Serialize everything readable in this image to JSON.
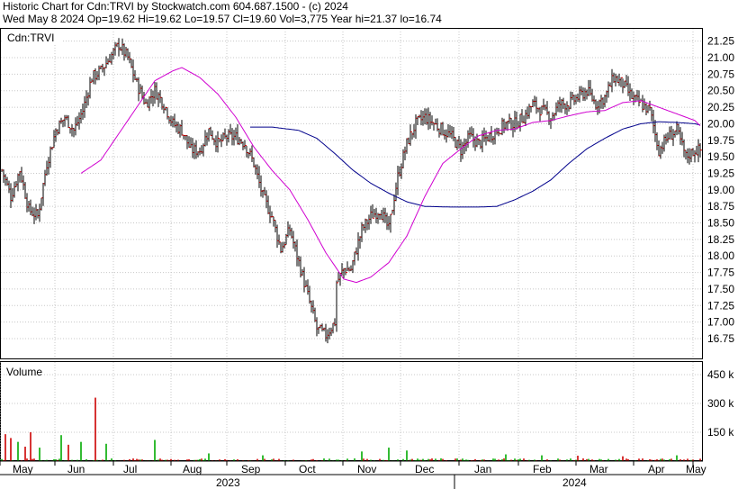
{
  "header": {
    "title_line": "Historic Chart for Cdn:TRVI by Stockwatch.com 604.687.1500 - (c) 2024",
    "stats_line": "Wed May  8 2024  Op=19.62  Hi=19.62  Lo=19.57  Cl=19.60  Vol=3,775  Year hi=21.37  lo=16.74"
  },
  "price_panel": {
    "symbol_label": "Cdn:TRVI"
  },
  "volume_panel": {
    "label": "Volume"
  },
  "colors": {
    "ohlc_bar": "#000000",
    "close_tick": "#cc0000",
    "ma_short": "#d000d0",
    "ma_long": "#00008b",
    "grid": "#c8c8c8",
    "volume_up": "#00aa00",
    "volume_down": "#cc0000"
  },
  "chart_data": {
    "type": "ohlc",
    "price_axis": {
      "ticks": [
        "21.25",
        "21.00",
        "20.75",
        "20.50",
        "20.25",
        "20.00",
        "19.75",
        "19.50",
        "19.25",
        "19.00",
        "18.75",
        "18.50",
        "18.25",
        "18.00",
        "17.75",
        "17.50",
        "17.25",
        "17.00",
        "16.75"
      ],
      "range": [
        16.45,
        21.45
      ]
    },
    "volume_axis": {
      "ticks": [
        "450 k",
        "300 k",
        "150 k"
      ],
      "range": [
        0,
        520000
      ]
    },
    "month_labels": [
      "May",
      "Jun",
      "Jul",
      "Aug",
      "Sep",
      "Oct",
      "Nov",
      "Dec",
      "Jan",
      "Feb",
      "Mar",
      "Apr",
      "May"
    ],
    "year_labels": [
      "2023",
      "2024"
    ],
    "price_keypoints": [
      [
        0,
        19.3
      ],
      [
        5,
        18.9
      ],
      [
        10,
        19.3
      ],
      [
        15,
        18.7
      ],
      [
        20,
        18.6
      ],
      [
        25,
        19.4
      ],
      [
        30,
        19.9
      ],
      [
        35,
        20.1
      ],
      [
        40,
        19.9
      ],
      [
        45,
        20.2
      ],
      [
        50,
        20.7
      ],
      [
        55,
        20.8
      ],
      [
        60,
        21.0
      ],
      [
        65,
        21.2
      ],
      [
        70,
        21.0
      ],
      [
        75,
        20.6
      ],
      [
        80,
        20.3
      ],
      [
        85,
        20.5
      ],
      [
        90,
        20.3
      ],
      [
        95,
        20.0
      ],
      [
        100,
        19.9
      ],
      [
        105,
        19.6
      ],
      [
        110,
        19.6
      ],
      [
        115,
        19.9
      ],
      [
        120,
        19.7
      ],
      [
        125,
        19.8
      ],
      [
        130,
        19.8
      ],
      [
        135,
        19.7
      ],
      [
        140,
        19.4
      ],
      [
        145,
        18.9
      ],
      [
        150,
        18.6
      ],
      [
        155,
        18.1
      ],
      [
        160,
        18.4
      ],
      [
        165,
        17.9
      ],
      [
        170,
        17.4
      ],
      [
        175,
        16.9
      ],
      [
        180,
        16.8
      ],
      [
        185,
        17.0
      ],
      [
        186,
        17.6
      ],
      [
        190,
        17.8
      ],
      [
        194,
        17.8
      ],
      [
        200,
        18.4
      ],
      [
        205,
        18.6
      ],
      [
        210,
        18.7
      ],
      [
        215,
        18.4
      ],
      [
        218,
        18.9
      ],
      [
        220,
        19.2
      ],
      [
        225,
        19.7
      ],
      [
        230,
        20.0
      ],
      [
        235,
        20.1
      ],
      [
        240,
        20.0
      ],
      [
        245,
        19.9
      ],
      [
        250,
        19.8
      ],
      [
        255,
        19.6
      ],
      [
        260,
        19.8
      ],
      [
        265,
        19.7
      ],
      [
        270,
        19.8
      ],
      [
        275,
        19.9
      ],
      [
        280,
        20.0
      ],
      [
        285,
        20.0
      ],
      [
        290,
        20.1
      ],
      [
        295,
        20.3
      ],
      [
        300,
        20.2
      ],
      [
        305,
        20.1
      ],
      [
        310,
        20.3
      ],
      [
        315,
        20.3
      ],
      [
        320,
        20.4
      ],
      [
        325,
        20.5
      ],
      [
        330,
        20.3
      ],
      [
        335,
        20.4
      ],
      [
        340,
        20.7
      ],
      [
        345,
        20.6
      ],
      [
        350,
        20.4
      ],
      [
        355,
        20.3
      ],
      [
        360,
        20.2
      ],
      [
        365,
        19.6
      ],
      [
        370,
        19.8
      ],
      [
        375,
        19.9
      ],
      [
        380,
        19.5
      ],
      [
        385,
        19.6
      ],
      [
        388,
        19.6
      ]
    ],
    "ma_short_keypoints": [
      [
        44,
        19.25
      ],
      [
        55,
        19.45
      ],
      [
        65,
        19.85
      ],
      [
        75,
        20.25
      ],
      [
        85,
        20.65
      ],
      [
        95,
        20.8
      ],
      [
        100,
        20.85
      ],
      [
        110,
        20.7
      ],
      [
        120,
        20.45
      ],
      [
        130,
        20.1
      ],
      [
        140,
        19.65
      ],
      [
        150,
        19.3
      ],
      [
        160,
        19.0
      ],
      [
        170,
        18.55
      ],
      [
        180,
        18.05
      ],
      [
        190,
        17.65
      ],
      [
        197,
        17.6
      ],
      [
        205,
        17.68
      ],
      [
        215,
        17.9
      ],
      [
        225,
        18.3
      ],
      [
        235,
        18.9
      ],
      [
        245,
        19.4
      ],
      [
        255,
        19.62
      ],
      [
        265,
        19.82
      ],
      [
        275,
        19.9
      ],
      [
        285,
        19.92
      ],
      [
        295,
        20.02
      ],
      [
        305,
        20.05
      ],
      [
        315,
        20.12
      ],
      [
        325,
        20.18
      ],
      [
        335,
        20.2
      ],
      [
        345,
        20.32
      ],
      [
        355,
        20.35
      ],
      [
        365,
        20.25
      ],
      [
        375,
        20.15
      ],
      [
        385,
        20.05
      ],
      [
        388,
        19.97
      ]
    ],
    "ma_long_keypoints": [
      [
        138,
        19.95
      ],
      [
        150,
        19.95
      ],
      [
        165,
        19.9
      ],
      [
        175,
        19.78
      ],
      [
        185,
        19.55
      ],
      [
        195,
        19.3
      ],
      [
        205,
        19.1
      ],
      [
        215,
        18.95
      ],
      [
        225,
        18.82
      ],
      [
        235,
        18.75
      ],
      [
        250,
        18.74
      ],
      [
        265,
        18.74
      ],
      [
        275,
        18.75
      ],
      [
        285,
        18.85
      ],
      [
        295,
        18.98
      ],
      [
        305,
        19.15
      ],
      [
        315,
        19.4
      ],
      [
        325,
        19.62
      ],
      [
        335,
        19.78
      ],
      [
        345,
        19.92
      ],
      [
        355,
        20.0
      ],
      [
        365,
        20.03
      ],
      [
        375,
        20.02
      ],
      [
        385,
        20.0
      ],
      [
        388,
        19.98
      ]
    ],
    "volume_spikes": [
      [
        2,
        140000
      ],
      [
        5,
        120000
      ],
      [
        9,
        100000
      ],
      [
        13,
        75000
      ],
      [
        16,
        150000
      ],
      [
        21,
        70000
      ],
      [
        33,
        135000
      ],
      [
        37,
        85000
      ],
      [
        44,
        100000
      ],
      [
        52,
        330000
      ],
      [
        58,
        90000
      ],
      [
        85,
        110000
      ],
      [
        115,
        40000
      ],
      [
        145,
        30000
      ],
      [
        200,
        50000
      ],
      [
        215,
        70000
      ],
      [
        225,
        55000
      ],
      [
        280,
        35000
      ],
      [
        300,
        30000
      ],
      [
        320,
        28000
      ],
      [
        345,
        25000
      ],
      [
        375,
        30000
      ]
    ]
  }
}
